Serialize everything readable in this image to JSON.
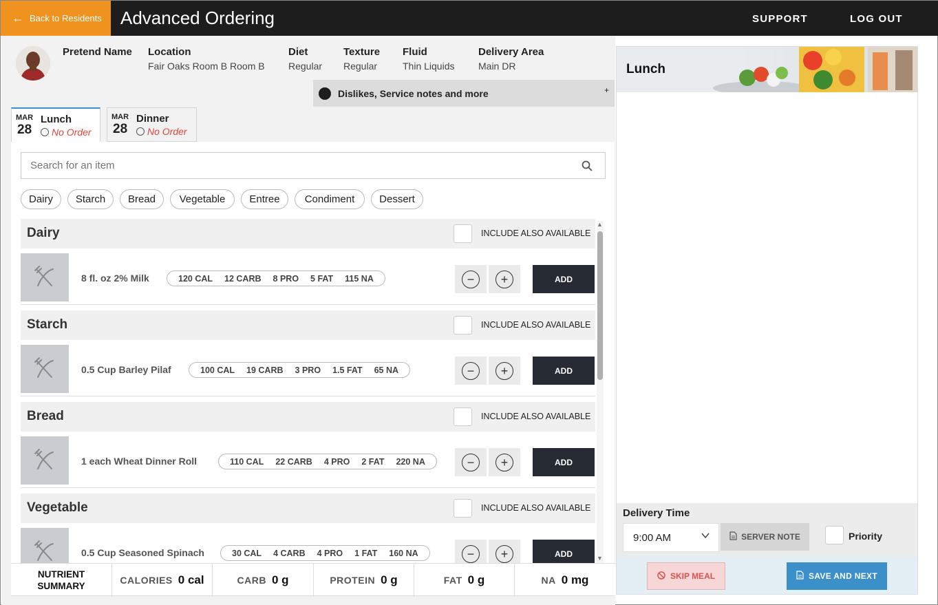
{
  "header": {
    "back_label": "Back to Residents",
    "title": "Advanced Ordering",
    "support_label": "SUPPORT",
    "logout_label": "LOG OUT",
    "accent_color": "#f0921e",
    "bar_color": "#1d1d1d"
  },
  "resident": {
    "name": "Pretend Name",
    "location_label": "Location",
    "location": "Fair Oaks Room B Room B",
    "diet_label": "Diet",
    "diet": "Regular",
    "texture_label": "Texture",
    "texture": "Regular",
    "fluid_label": "Fluid",
    "fluid": "Thin Liquids",
    "delivery_area_label": "Delivery Area",
    "delivery_area": "Main DR"
  },
  "dislikes": {
    "label": "Dislikes, Service notes and more",
    "toggle": "+"
  },
  "meal_tabs": [
    {
      "month": "MAR",
      "day": "28",
      "meal": "Lunch",
      "status": "No Order"
    },
    {
      "month": "MAR",
      "day": "28",
      "meal": "Dinner",
      "status": "No Order"
    }
  ],
  "search": {
    "placeholder": "Search for an item",
    "icon": "search-icon"
  },
  "filters": [
    "Dairy",
    "Starch",
    "Bread",
    "Vegetable",
    "Entree",
    "Condiment",
    "Dessert"
  ],
  "include_label": "INCLUDE ALSO AVAILABLE",
  "add_label": "ADD",
  "categories": [
    {
      "title": "Dairy",
      "item": {
        "name": "8 fl. oz 2% Milk",
        "cal": "120 CAL",
        "carb": "12 CARB",
        "pro": "8 PRO",
        "fat": "5 FAT",
        "na": "115 NA"
      }
    },
    {
      "title": "Starch",
      "item": {
        "name": "0.5 Cup Barley Pilaf",
        "cal": "100 CAL",
        "carb": "19 CARB",
        "pro": "3 PRO",
        "fat": "1.5 FAT",
        "na": "65 NA"
      }
    },
    {
      "title": "Bread",
      "item": {
        "name": "1 each Wheat Dinner Roll",
        "cal": "110 CAL",
        "carb": "22 CARB",
        "pro": "4 PRO",
        "fat": "2 FAT",
        "na": "220 NA"
      }
    },
    {
      "title": "Vegetable",
      "item": {
        "name": "0.5 Cup Seasoned Spinach",
        "cal": "30 CAL",
        "carb": "4 CARB",
        "pro": "4 PRO",
        "fat": "1 FAT",
        "na": "160 NA"
      }
    }
  ],
  "summary": {
    "title_line1": "NUTRIENT",
    "title_line2": "SUMMARY",
    "calories_label": "CALORIES",
    "calories": "0 cal",
    "carb_label": "CARB",
    "carb": "0 g",
    "protein_label": "PROTEIN",
    "protein": "0 g",
    "fat_label": "FAT",
    "fat": "0 g",
    "na_label": "NA",
    "na": "0 mg"
  },
  "order_panel": {
    "title": "Lunch",
    "delivery_time_label": "Delivery Time",
    "delivery_time": "9:00 AM",
    "server_note_label": "SERVER NOTE",
    "priority_label": "Priority",
    "skip_label": "SKIP MEAL",
    "save_label": "SAVE AND NEXT",
    "skip_color": "#d9534f",
    "save_color": "#3b90c9"
  }
}
